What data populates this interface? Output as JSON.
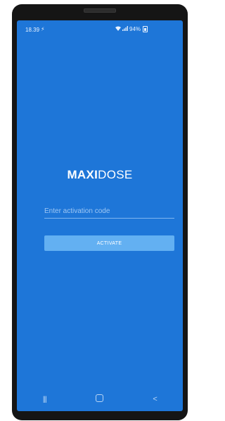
{
  "status_bar": {
    "time": "18.39",
    "charging_icon": "charging-bolt-icon",
    "battery": "94%"
  },
  "logo": {
    "bold": "MAXI",
    "light": "DOSE"
  },
  "activation": {
    "placeholder": "Enter activation code",
    "value": "",
    "button_label": "ACTIVATE"
  },
  "nav_bar": {
    "recent_icon": "recent-apps-icon",
    "home_icon": "home-icon",
    "back_icon": "back-icon"
  },
  "colors": {
    "screen_background": "#1e76d8",
    "button_background": "#63b0f2",
    "input_underline": "#7fb5ef",
    "device_frame": "#151515"
  }
}
